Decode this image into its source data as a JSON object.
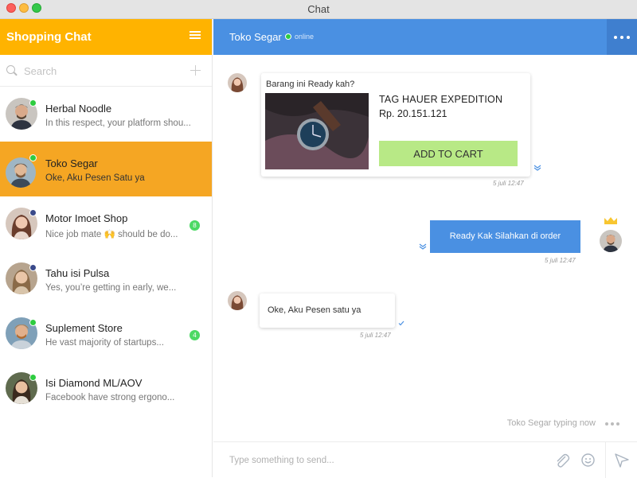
{
  "window": {
    "title": "Chat"
  },
  "sidebar": {
    "title": "Shopping Chat",
    "search": {
      "placeholder": "Search",
      "value": ""
    },
    "contacts": [
      {
        "name": "Herbal Noodle",
        "preview": "In this respect, your platform shou...",
        "status": "online",
        "badge": "",
        "active": false
      },
      {
        "name": "Toko Segar",
        "preview": "Oke, Aku Pesen Satu ya",
        "status": "online",
        "badge": "",
        "active": true
      },
      {
        "name": "Motor Imoet Shop",
        "preview": "Nice job mate 🙌 should be do...",
        "status": "away",
        "badge": "8",
        "active": false
      },
      {
        "name": "Tahu isi Pulsa",
        "preview": "Yes, you’re getting in early, we...",
        "status": "away",
        "badge": "",
        "active": false
      },
      {
        "name": "Suplement Store",
        "preview": "He vast majority of startups...",
        "status": "online",
        "badge": "4",
        "active": false
      },
      {
        "name": "Isi Diamond ML/AOV",
        "preview": "Facebook have strong ergono...",
        "status": "online",
        "badge": "",
        "active": false
      }
    ]
  },
  "chat": {
    "contact_name": "Toko Segar",
    "status_text": "online",
    "messages": {
      "product_card": {
        "question": "Barang ini Ready kah?",
        "product_name": "TAG HAUER EXPEDITION",
        "price": "Rp. 20.151.121",
        "button_label": "ADD TO CART",
        "time": "5 juli 12:47"
      },
      "outgoing": {
        "text": "Ready Kak Silahkan di order",
        "time": "5 juli 12:47"
      },
      "incoming": {
        "text": "Oke, Aku Pesen satu ya",
        "time": "5 juli 12:47"
      }
    },
    "typing_text": "Toko Segar typing now",
    "composer": {
      "placeholder": "Type something to send...",
      "value": ""
    }
  },
  "colors": {
    "sidebar_header": "#ffb300",
    "active_contact": "#f5a623",
    "chat_header": "#4a90e2",
    "add_to_cart": "#b8e986",
    "online": "#2ecc40",
    "badge": "#4cd964"
  },
  "icons": [
    "menu-icon",
    "search-icon",
    "plus-icon",
    "more-icon",
    "crown-icon",
    "attach-icon",
    "emoji-icon",
    "send-icon",
    "double-check-icon"
  ]
}
